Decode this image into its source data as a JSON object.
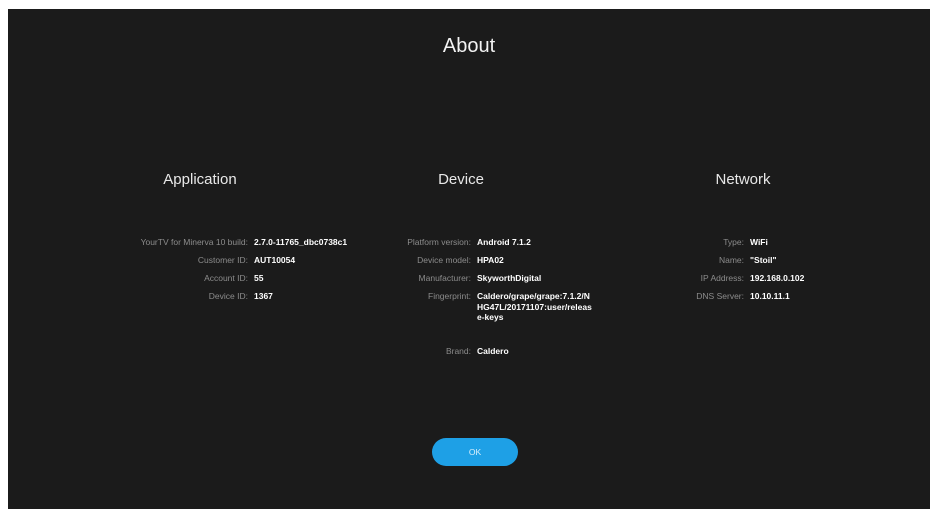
{
  "title": "About",
  "sections": {
    "application": {
      "heading": "Application",
      "rows": [
        {
          "label": "YourTV for Minerva 10 build:",
          "value": "2.7.0-11765_dbc0738c1"
        },
        {
          "label": "Customer ID:",
          "value": "AUT10054"
        },
        {
          "label": "Account ID:",
          "value": "55"
        },
        {
          "label": "Device ID:",
          "value": "1367"
        }
      ]
    },
    "device": {
      "heading": "Device",
      "rows": [
        {
          "label": "Platform version:",
          "value": "Android 7.1.2"
        },
        {
          "label": "Device model:",
          "value": "HPA02"
        },
        {
          "label": "Manufacturer:",
          "value": "SkyworthDigital"
        },
        {
          "label": "Fingerprint:",
          "value": "Caldero/grape/grape:7.1.2/NHG47L/20171107:user/release-keys"
        },
        {
          "label": "Brand:",
          "value": "Caldero"
        }
      ]
    },
    "network": {
      "heading": "Network",
      "rows": [
        {
          "label": "Type:",
          "value": "WiFi"
        },
        {
          "label": "Name:",
          "value": "\"Stoil\""
        },
        {
          "label": "IP Address:",
          "value": "192.168.0.102"
        },
        {
          "label": "DNS Server:",
          "value": "10.10.11.1"
        }
      ]
    }
  },
  "ok_button": {
    "label": "OK"
  },
  "colors": {
    "background": "#1b1b1b",
    "accent": "#1ea0e6",
    "label": "#8c8c8c",
    "value": "#ffffff"
  }
}
